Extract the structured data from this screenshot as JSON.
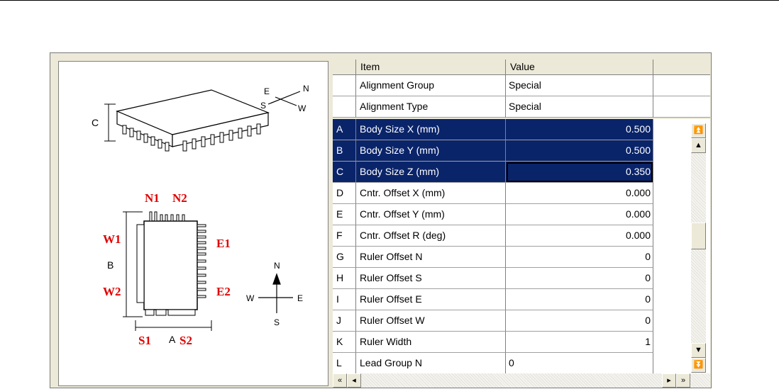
{
  "grid": {
    "headers": [
      "",
      "Item",
      "Value"
    ],
    "fixed_rows": [
      {
        "key": "",
        "item": "Alignment Group",
        "value": "Special"
      },
      {
        "key": "",
        "item": "Alignment Type",
        "value": "Special"
      }
    ],
    "rows": [
      {
        "key": "A",
        "item": "Body Size X (mm)",
        "value": "0.500"
      },
      {
        "key": "B",
        "item": "Body Size Y (mm)",
        "value": "0.500"
      },
      {
        "key": "C",
        "item": "Body Size Z (mm)",
        "value": "0.350"
      },
      {
        "key": "D",
        "item": "Cntr. Offset X (mm)",
        "value": "0.000"
      },
      {
        "key": "E",
        "item": "Cntr. Offset Y (mm)",
        "value": "0.000"
      },
      {
        "key": "F",
        "item": "Cntr. Offset R (deg)",
        "value": "0.000"
      },
      {
        "key": "G",
        "item": "Ruler Offset N",
        "value": "0"
      },
      {
        "key": "H",
        "item": "Ruler Offset S",
        "value": "0"
      },
      {
        "key": "I",
        "item": "Ruler Offset E",
        "value": "0"
      },
      {
        "key": "J",
        "item": "Ruler Offset W",
        "value": "0"
      },
      {
        "key": "K",
        "item": "Ruler Width",
        "value": "1"
      },
      {
        "key": "L",
        "item": "Lead Group N",
        "value": "0"
      }
    ]
  },
  "diagram": {
    "compass_top": {
      "e": "E",
      "n": "N",
      "s": "S",
      "w": "W"
    },
    "compass_bottom": {
      "n": "N",
      "s": "S",
      "w": "W",
      "e": "E"
    },
    "dims": {
      "c": "C",
      "b": "B",
      "a": "A"
    },
    "leads": {
      "n1": "N1",
      "n2": "N2",
      "w1": "W1",
      "w2": "W2",
      "e1": "E1",
      "e2": "E2",
      "s1": "S1",
      "s2": "S2"
    }
  },
  "colors": {
    "selection": "#0a246a",
    "lead_label": "#e00000",
    "panel": "#ece9d8"
  },
  "icons": {
    "scroll_top": "double-up-arrow-icon",
    "scroll_up": "up-arrow-icon",
    "scroll_down": "down-arrow-icon",
    "scroll_bottom": "double-down-arrow-icon",
    "scroll_left_end": "double-left-arrow-icon",
    "scroll_left": "left-arrow-icon",
    "scroll_right": "right-arrow-icon",
    "scroll_right_end": "double-right-arrow-icon"
  }
}
